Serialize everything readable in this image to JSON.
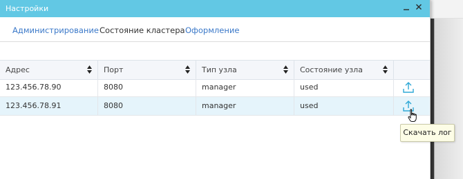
{
  "window": {
    "title": "Настройки",
    "minimize_label": "_",
    "close_label": "✕"
  },
  "tabs": [
    {
      "label": "Администрирование",
      "active": false
    },
    {
      "label": "Состояние кластера",
      "active": true
    },
    {
      "label": "Оформление",
      "active": false
    }
  ],
  "table": {
    "columns": [
      "Адрес",
      "Порт",
      "Тип узла",
      "Состояние узла"
    ],
    "rows": [
      {
        "address": "123.456.78.90",
        "port": "8080",
        "node_type": "manager",
        "node_state": "used",
        "selected": false
      },
      {
        "address": "123.456.78.91",
        "port": "8080",
        "node_type": "manager",
        "node_state": "used",
        "selected": true
      }
    ]
  },
  "tooltip": {
    "text": "Скачать лог"
  },
  "icons": {
    "download": "upload-arrow-icon",
    "sort": "sort-arrows-icon",
    "cursor": "hand-pointer-icon"
  },
  "colors": {
    "titlebar": "#62c8e4",
    "tab_link": "#3b79c9",
    "selected_row": "#e5f4fb",
    "icon": "#2ea8d6"
  }
}
